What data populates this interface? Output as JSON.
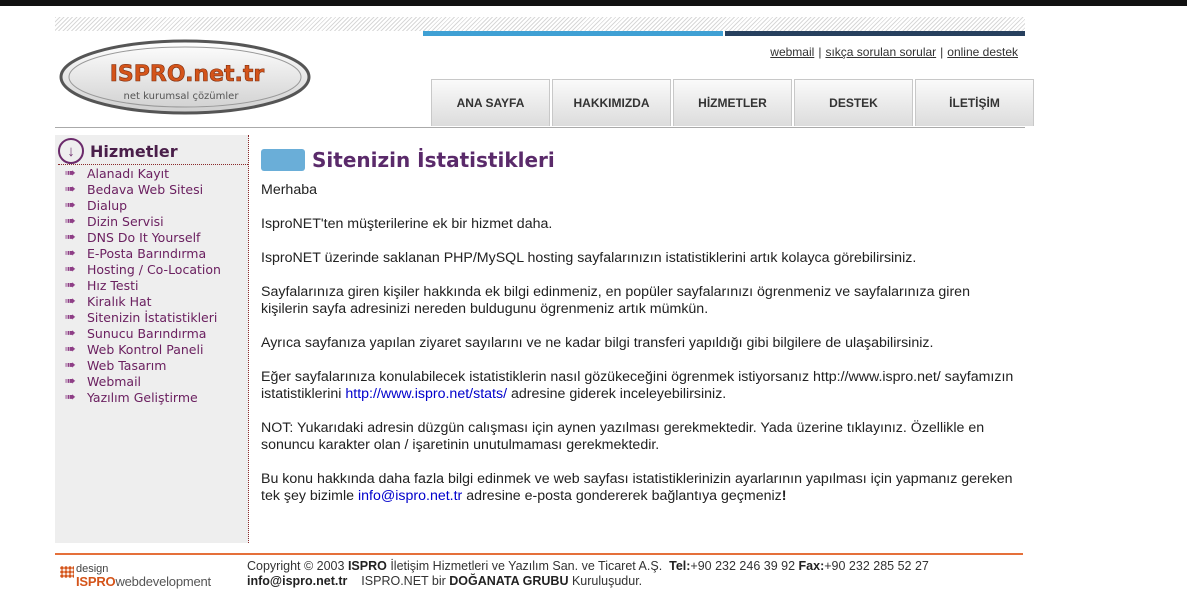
{
  "colors": {
    "accent_bar_left": "#3fa0d4",
    "accent_bar_right": "#27405e",
    "title": "#5a2a6a",
    "sidebar_text": "#6b2060",
    "footer_line": "#e5703a"
  },
  "logo": {
    "name": "ISPRO.net.tr",
    "tagline": "net kurumsal çözümler"
  },
  "toplinks": {
    "webmail": "webmail",
    "faq": "sıkça sorulan sorular",
    "support": "online destek",
    "separator": "|"
  },
  "nav": {
    "tabs": [
      "ANA SAYFA",
      "HAKKIMIZDA",
      "HİZMETLER",
      "DESTEK",
      "İLETİŞİM"
    ]
  },
  "sidebar": {
    "title": "Hizmetler",
    "head_icon": "arrow-down-circle-icon",
    "items": [
      "Alanadı Kayıt",
      "Bedava Web Sitesi",
      "Dialup",
      "Dizin Servisi",
      "DNS Do It Yourself",
      "E-Posta Barındırma",
      "Hosting / Co-Location",
      "Hız Testi",
      "Kiralık Hat",
      "Sitenizin İstatistikleri",
      "Sunucu Barındırma",
      "Web Kontrol Paneli",
      "Web Tasarım",
      "Webmail",
      "Yazılım Geliştirme"
    ]
  },
  "content": {
    "title": "Sitenizin İstatistikleri",
    "p1": "Merhaba",
    "p2": "IsproNET'ten müşterilerine ek bir hizmet daha.",
    "p3": "IsproNET üzerinde saklanan PHP/MySQL hosting sayfalarınızın istatistiklerini artık kolayca görebilirsiniz.",
    "p4": "Sayfalarınıza giren kişiler hakkında ek bilgi edinmeniz, en popüler sayfalarınızı ögrenmeniz ve sayfalarınıza giren kişilerin sayfa adresinizi nereden buldugunu ögrenmeniz artık mümkün.",
    "p5": "Ayrıca sayfanıza yapılan ziyaret sayılarını ve ne kadar bilgi transferi yapıldığı gibi bilgilere de ulaşabilirsiniz.",
    "p6_pre": "Eğer sayfalarınıza konulabilecek istatistiklerin nasıl gözükeceğini ögrenmek istiyorsanız http://www.ispro.net/ sayfamızın istatistiklerini ",
    "p6_link": "http://www.ispro.net/stats/",
    "p6_post": " adresine giderek inceleyebilirsiniz.",
    "p7": "NOT: Yukarıdaki adresin düzgün calışması için aynen yazılması gerekmektedir. Yada üzerine tıklayınız. Özellikle en sonuncu karakter olan / işaretinin unutulmaması gerekmektedir.",
    "p8_pre": "Bu konu hakkında daha fazla bilgi edinmek ve web sayfası istatistiklerinizin ayarlarının yapılması için yapmanız gereken tek şey bizimle ",
    "p8_link": "info@ispro.net.tr",
    "p8_post": " adresine e-posta gondererek bağlantıya geçmeniz",
    "p8_end": "!"
  },
  "footer": {
    "logo_design": "design",
    "logo_brand": "ISPRO",
    "logo_suffix": "webdevelopment",
    "copyright": "Copyright © 2003 ",
    "company_bold": "ISPRO",
    "company_rest": " İletişim Hizmetleri ve Yazılım San. ve Ticaret A.Ş.",
    "tel_label": "Tel:",
    "tel": "+90 232 246 39 92",
    "fax_label": "Fax:",
    "fax": "+90 232 285 52 27",
    "email": "info@ispro.net.tr",
    "group_pre": "ISPRO.NET bir ",
    "group_bold": "DOĞANATA GRUBU",
    "group_post": " Kuruluşudur."
  }
}
